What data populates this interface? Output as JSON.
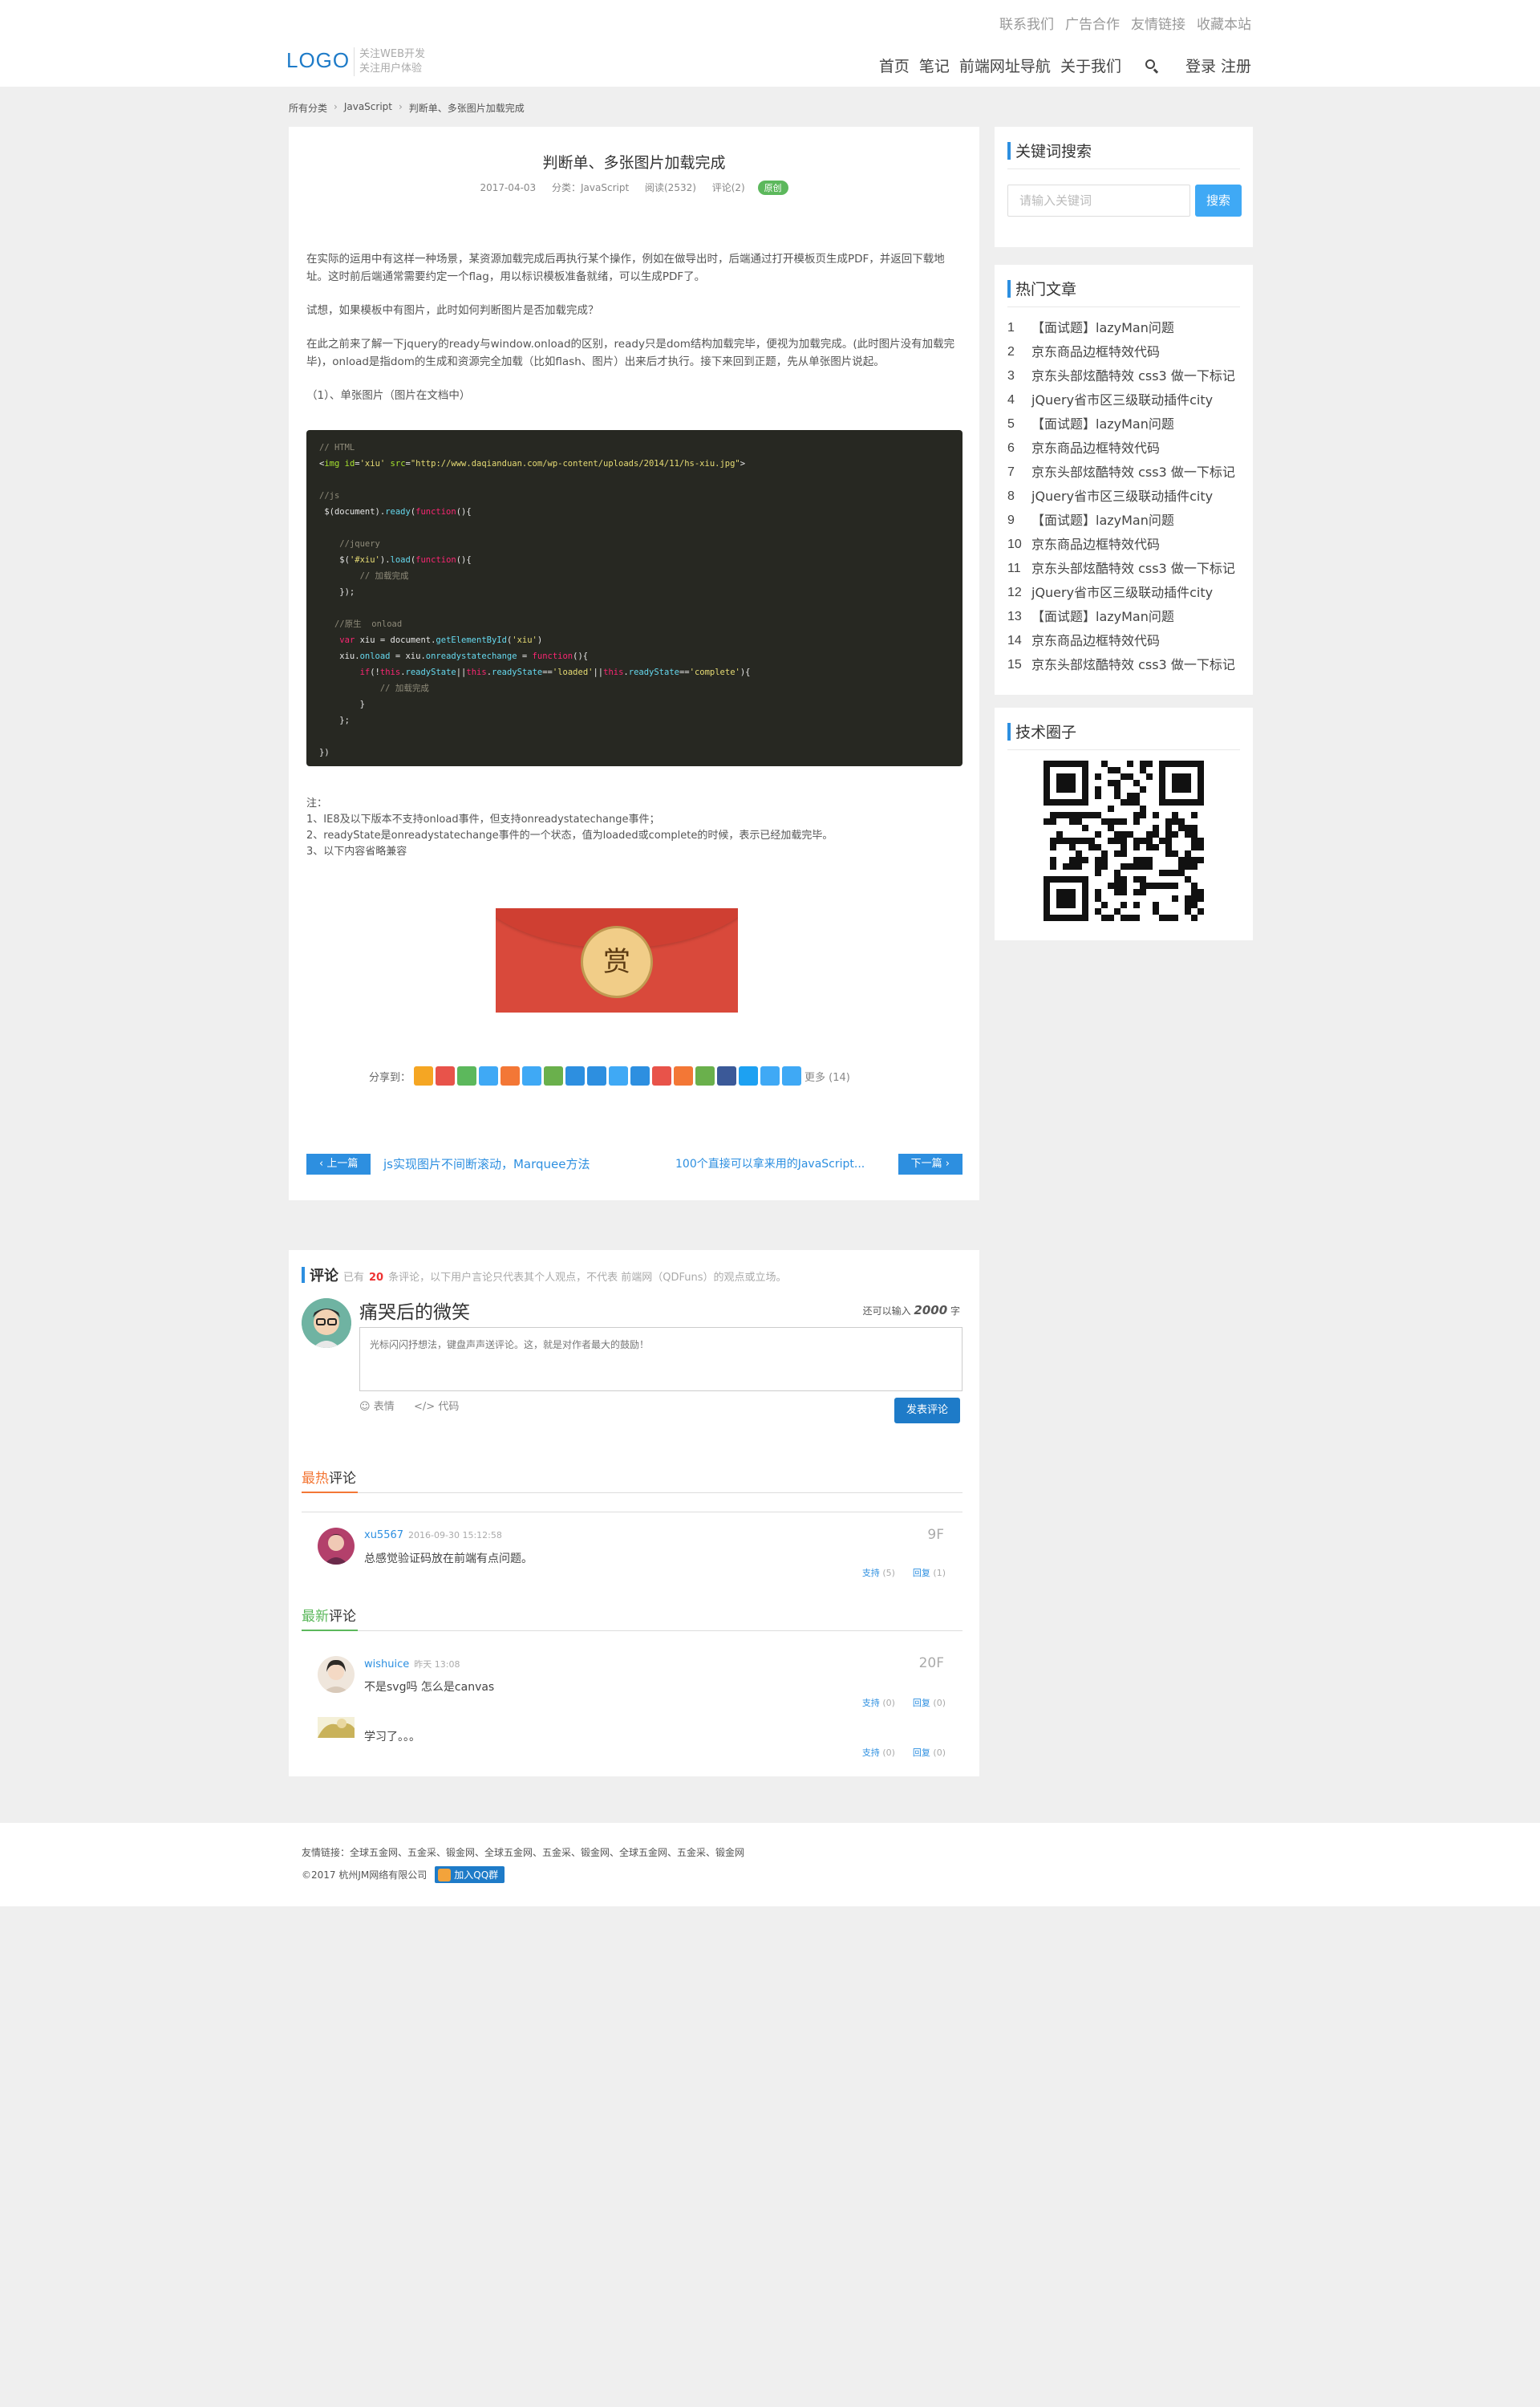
{
  "header": {
    "top_links": [
      "联系我们",
      "广告合作",
      "友情链接",
      "收藏本站"
    ],
    "logo": "LOGO",
    "tagline_1": "关注WEB开发",
    "tagline_2": "关注用户体验",
    "nav": [
      "首页",
      "笔记",
      "前端网址导航",
      "关于我们"
    ],
    "auth": "登录 注册",
    "search_icon": "search-icon"
  },
  "breadcrumb": [
    "所有分类",
    "JavaScript",
    "判断单、多张图片加载完成"
  ],
  "article": {
    "title": "判断单、多张图片加载完成",
    "date": "2017-04-03",
    "category": "分类：JavaScript",
    "views": "阅读(2532)",
    "comments": "评论(2)",
    "tag": "原创",
    "p1": "在实际的运用中有这样一种场景，某资源加载完成后再执行某个操作，例如在做导出时，后端通过打开模板页生成PDF，并返回下载地址。这时前后端通常需要约定一个flag，用以标识模板准备就绪，可以生成PDF了。",
    "p2": "试想，如果模板中有图片，此时如何判断图片是否加载完成？",
    "p3": "在此之前来了解一下jquery的ready与window.onload的区别，ready只是dom结构加载完毕，便视为加载完成。(此时图片没有加载完毕)，onload是指dom的生成和资源完全加载（比如flash、图片）出来后才执行。接下来回到正题，先从单张图片说起。",
    "p4": "（1）、单张图片（图片在文档中）",
    "code_lines": [
      "// HTML",
      "<img id='xiu' src=\"http://www.daqianduan.com/wp-content/uploads/2014/11/hs-xiu.jpg\">",
      "",
      "//js",
      " $(document).ready(function(){",
      "",
      "    //jquery",
      "    $('#xiu').load(function(){",
      "        // 加载完成",
      "    });",
      "",
      "   //原生  onload",
      "    var xiu = document.getElementById('xiu')",
      "    xiu.onload = xiu.onreadystatechange = function(){",
      "        if(!this.readyState||this.readyState=='loaded'||this.readyState=='complete'){",
      "            // 加载完成",
      "        }",
      "    };",
      "",
      "})"
    ],
    "note_title": "注：",
    "note_1": "1、IE8及以下版本不支持onload事件，但支持onreadystatechange事件；",
    "note_2": "2、readyState是onreadystatechange事件的一个状态，值为loaded或complete的时候，表示已经加载完毕。",
    "note_3": "3、以下内容省略兼容",
    "reward": "赏",
    "share_label": "分享到：",
    "share_more": "更多 (14)",
    "share_colors": [
      "#f5a623",
      "#e8534a",
      "#5cb85c",
      "#3fa9f5",
      "#f37736",
      "#3fa9f5",
      "#6ab04c",
      "#2d8fe0",
      "#2d8fe0",
      "#3fa9f5",
      "#2d8fe0",
      "#e8534a",
      "#f37736",
      "#6ab04c",
      "#3b5998",
      "#1da1f2",
      "#3fa9f5",
      "#3fa9f5"
    ],
    "prev_label": "上一篇",
    "prev_link": "js实现图片不间断滚动，Marquee方法",
    "next_label": "下一篇",
    "next_link": "100个直接可以拿来用的JavaScript..."
  },
  "comments": {
    "title": "评论",
    "count_prefix": "已有",
    "count": "20",
    "count_suffix": "条评论，以下用户言论只代表其个人观点，不代表 前端网（QDFuns）的观点或立场。",
    "me_name": "痛哭后的微笑",
    "limit_prefix": "还可以输入",
    "limit_num": "2000",
    "limit_suffix": "字",
    "placeholder": "光标闪闪抒想法，键盘声声送评论。这，就是对作者最大的鼓励！",
    "emoji": "表情",
    "code": "代码",
    "submit": "发表评论",
    "hot_hl": "最热",
    "hot_rest": "评论",
    "new_hl": "最新",
    "new_rest": "评论",
    "support": "支持",
    "reply": "回复",
    "items": [
      {
        "user": "xu5567",
        "time": "2016-09-30 15:12:58",
        "floor": "9F",
        "text": "总感觉验证码放在前端有点问题。",
        "support_n": "(5)",
        "reply_n": "(1)"
      },
      {
        "user": "wishuice",
        "time": "昨天 13:08",
        "floor": "20F",
        "text": "不是svg吗 怎么是canvas",
        "support_n": "(0)",
        "reply_n": "(0)"
      },
      {
        "user": "",
        "time": "",
        "floor": "",
        "text": "学习了。。。",
        "support_n": "(0)",
        "reply_n": "(0)"
      }
    ]
  },
  "sidebar": {
    "search_title": "关键词搜索",
    "search_placeholder": "请输入关键词",
    "search_btn": "搜索",
    "hot_title": "热门文章",
    "hot": [
      "【面试题】lazyMan问题",
      "京东商品边框特效代码",
      "京东头部炫酷特效 css3 做一下标记",
      "jQuery省市区三级联动插件city",
      "【面试题】lazyMan问题",
      "京东商品边框特效代码",
      "京东头部炫酷特效 css3 做一下标记",
      "jQuery省市区三级联动插件city",
      "【面试题】lazyMan问题",
      "京东商品边框特效代码",
      "京东头部炫酷特效 css3 做一下标记",
      "jQuery省市区三级联动插件city",
      "【面试题】lazyMan问题",
      "京东商品边框特效代码",
      "京东头部炫酷特效 css3 做一下标记"
    ],
    "circle_title": "技术圈子"
  },
  "footer": {
    "links": "友情链接：全球五金网、五金采、锻金网、全球五金网、五金采、锻金网、全球五金网、五金采、锻金网",
    "copy": "©2017 杭州JM网络有限公司",
    "qq_btn": "加入QQ群"
  }
}
